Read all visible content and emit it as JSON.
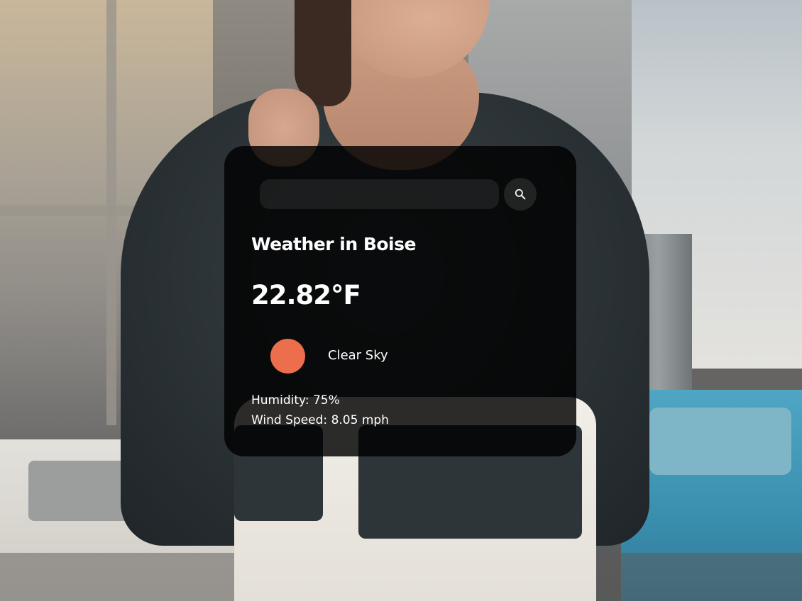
{
  "search": {
    "value": "",
    "placeholder": "",
    "button_icon": "search-icon"
  },
  "weather": {
    "title": "Weather in Boise",
    "temperature": "22.82°F",
    "condition": "Clear Sky",
    "condition_icon": "sun-icon",
    "condition_icon_color": "#ec6e4c",
    "humidity_label": "Humidity: ",
    "humidity_value": "75%",
    "wind_label": "Wind Speed: ",
    "wind_value": "8.05 mph"
  }
}
